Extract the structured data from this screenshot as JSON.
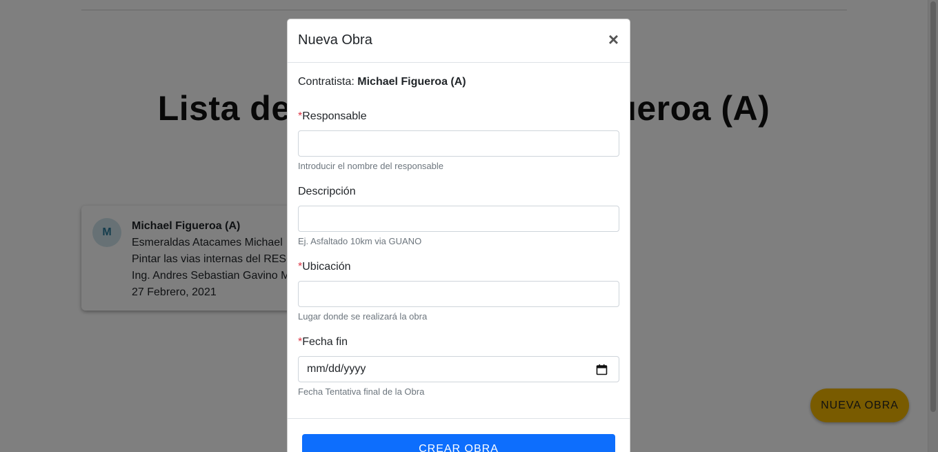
{
  "page": {
    "title": "Lista de Obras: Michael Figueroa (A)"
  },
  "card": {
    "avatar_letter": "M",
    "name": "Michael Figueroa (A)",
    "line1": "Esmeraldas Atacames Michael",
    "line2": "Pintar las vias internas del RESO",
    "line3": "Ing. Andres Sebastian Gavino M",
    "line4": "27 Febrero, 2021"
  },
  "fab": {
    "label": "NUEVA OBRA"
  },
  "modal": {
    "title": "Nueva Obra",
    "close_symbol": "×",
    "contractor_label": "Contratista:",
    "contractor_name": "Michael Figueroa (A)",
    "required_mark": "*",
    "fields": {
      "responsable": {
        "label": "Responsable",
        "value": "",
        "help": "Introducir el nombre del responsable"
      },
      "descripcion": {
        "label": "Descripción",
        "value": "",
        "help": "Ej. Asfaltado 10km via GUANO"
      },
      "ubicacion": {
        "label": "Ubicación",
        "value": "",
        "help": "Lugar donde se realizará la obra"
      },
      "fecha_fin": {
        "label": "Fecha fin",
        "placeholder": "mm/dd/yyyy",
        "help": "Fecha Tentativa final de la Obra"
      }
    },
    "submit_label": "CREAR OBRA"
  },
  "colors": {
    "primary": "#0d6efd",
    "fab": "#f2b600",
    "required": "#dc3545",
    "backdrop": "rgba(0,0,0,0.5)"
  },
  "icons": {
    "close": "close-icon",
    "calendar": "calendar-icon"
  }
}
